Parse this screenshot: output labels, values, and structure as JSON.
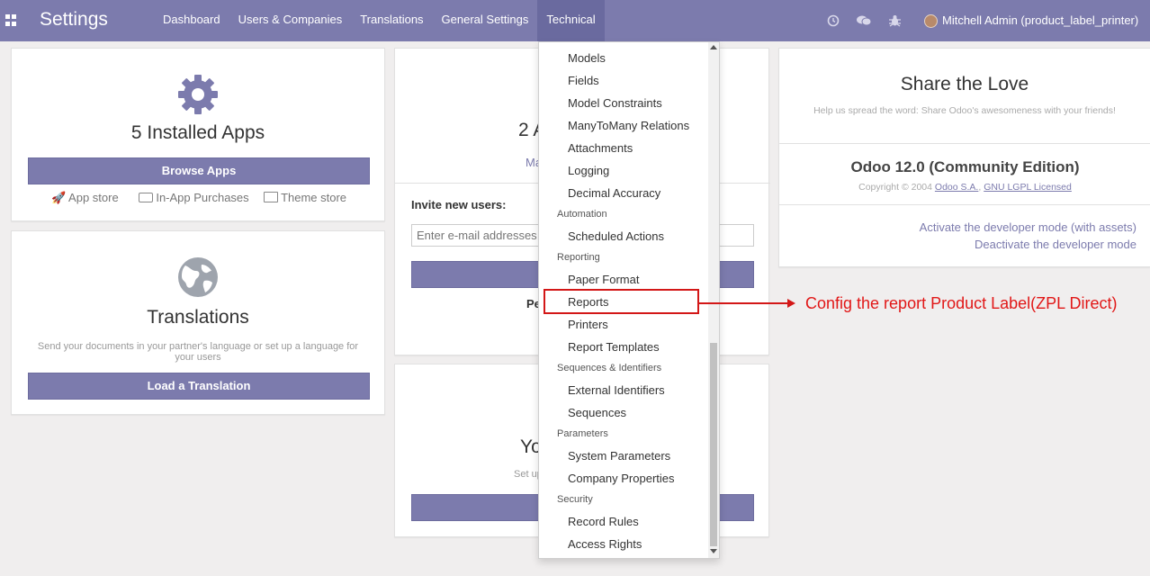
{
  "navbar": {
    "app_title": "Settings",
    "menu": [
      "Dashboard",
      "Users & Companies",
      "Translations",
      "General Settings",
      "Technical"
    ],
    "user": "Mitchell Admin (product_label_printer)"
  },
  "apps_card": {
    "title": "5 Installed Apps",
    "button": "Browse Apps",
    "links": [
      "App store",
      "In-App Purchases",
      "Theme store"
    ]
  },
  "translations_card": {
    "title": "Translations",
    "description": "Send your documents in your partner's language or set up a language for your users",
    "button": "Load a Translation"
  },
  "users_card": {
    "title_partial": "2 A",
    "link_partial": "Ma",
    "invite_label": "Invite new users:",
    "invite_placeholder": "Enter e-mail addresses",
    "pending_partial": "Pe"
  },
  "company_card": {
    "title_partial": "Yo",
    "text_partial": "Set up"
  },
  "share_card": {
    "title": "Share the Love",
    "subtitle": "Help us spread the word: Share Odoo's awesomeness with your friends!",
    "version": "Odoo 12.0 (Community Edition)",
    "copyright_prefix": "Copyright © 2004",
    "company_link": "Odoo S.A.",
    "license_link": "GNU LGPL Licensed",
    "dev_mode_assets": "Activate the developer mode (with assets)",
    "dev_mode_off": "Deactivate the developer mode"
  },
  "technical_menu": {
    "items": [
      {
        "type": "item",
        "label": "Models"
      },
      {
        "type": "item",
        "label": "Fields"
      },
      {
        "type": "item",
        "label": "Model Constraints"
      },
      {
        "type": "item",
        "label": "ManyToMany Relations"
      },
      {
        "type": "item",
        "label": "Attachments"
      },
      {
        "type": "item",
        "label": "Logging"
      },
      {
        "type": "item",
        "label": "Decimal Accuracy"
      },
      {
        "type": "header",
        "label": "Automation"
      },
      {
        "type": "item",
        "label": "Scheduled Actions"
      },
      {
        "type": "header",
        "label": "Reporting"
      },
      {
        "type": "item",
        "label": "Paper Format"
      },
      {
        "type": "item",
        "label": "Reports"
      },
      {
        "type": "item",
        "label": "Printers"
      },
      {
        "type": "item",
        "label": "Report Templates"
      },
      {
        "type": "header",
        "label": "Sequences & Identifiers"
      },
      {
        "type": "item",
        "label": "External Identifiers"
      },
      {
        "type": "item",
        "label": "Sequences"
      },
      {
        "type": "header",
        "label": "Parameters"
      },
      {
        "type": "item",
        "label": "System Parameters"
      },
      {
        "type": "item",
        "label": "Company Properties"
      },
      {
        "type": "header",
        "label": "Security"
      },
      {
        "type": "item",
        "label": "Record Rules"
      },
      {
        "type": "item",
        "label": "Access Rights"
      }
    ]
  },
  "annotation": {
    "text": "Config the report Product Label(ZPL Direct)",
    "color": "#e11717"
  },
  "colors": {
    "brand": "#7c7bad",
    "background": "#f0eeee"
  }
}
